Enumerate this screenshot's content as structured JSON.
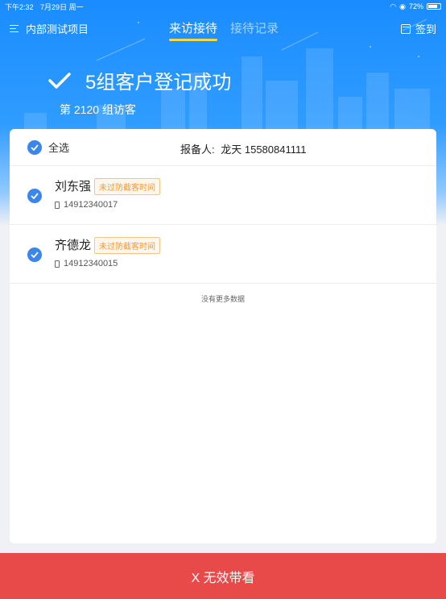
{
  "status_bar": {
    "time": "下午2:32",
    "date": "7月29日 周一",
    "battery": "72%"
  },
  "nav": {
    "project": "内部测试项目",
    "tabs": [
      {
        "label": "来访接待",
        "active": true
      },
      {
        "label": "接待记录",
        "active": false
      }
    ],
    "signin": "签到"
  },
  "success": {
    "title": "5组客户登记成功",
    "visitor_number": "第 2120 组访客"
  },
  "list": {
    "select_all": "全选",
    "reporter_label": "报备人:",
    "reporter_value": "龙天 15580841111",
    "customers": [
      {
        "name": "刘东强",
        "badge": "未过防截客时间",
        "phone": "14912340017",
        "checked": true
      },
      {
        "name": "齐德龙",
        "badge": "未过防截客时间",
        "phone": "14912340015",
        "checked": true
      }
    ],
    "no_more": "没有更多数据"
  },
  "bottom_button": "X 无效带看",
  "colors": {
    "primary": "#1a8cff",
    "check": "#3a86ea",
    "badge": "#f09a3c",
    "danger": "#e84a4a",
    "tab_underline": "#f7d84a"
  }
}
